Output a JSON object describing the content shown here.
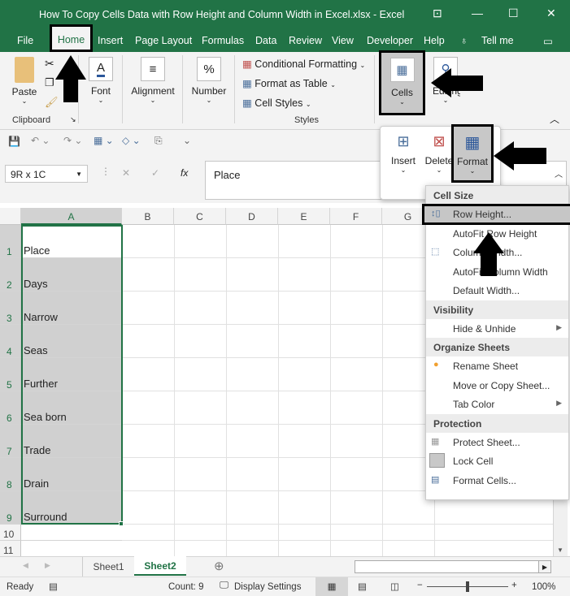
{
  "window": {
    "title": "How To Copy Cells Data with Row Height and Column Width in Excel.xlsx  -  Excel"
  },
  "menu": {
    "tabs": [
      "File",
      "Home",
      "Insert",
      "Page Layout",
      "Formulas",
      "Data",
      "Review",
      "View",
      "Developer",
      "Help"
    ],
    "tell_me": "Tell me"
  },
  "ribbon": {
    "paste": "Paste",
    "clipboard": "Clipboard",
    "font": "Font",
    "alignment": "Alignment",
    "number": "Number",
    "conditional_formatting": "Conditional Formatting",
    "format_as_table": "Format as Table",
    "cell_styles": "Cell Styles",
    "styles": "Styles",
    "cells": "Cells",
    "editing": "Editing"
  },
  "cells_popup": {
    "insert": "Insert",
    "delete": "Delete",
    "format": "Format"
  },
  "formula_bar": {
    "name_box": "9R x 1C",
    "fx": "fx",
    "value": "Place"
  },
  "grid": {
    "columns": [
      "A",
      "B",
      "C",
      "D",
      "E",
      "F",
      "G"
    ],
    "rows": [
      "1",
      "2",
      "3",
      "4",
      "5",
      "6",
      "7",
      "8",
      "9",
      "10",
      "11"
    ],
    "column_a": [
      "Place",
      "Days",
      "Narrow",
      "Seas",
      "Further",
      "Sea born",
      "Trade",
      "Drain",
      "Surround",
      "",
      ""
    ]
  },
  "format_menu": {
    "cell_size": "Cell Size",
    "row_height": "Row Height...",
    "autofit_row_height": "AutoFit Row Height",
    "column_width": "Column Width...",
    "autofit_column_width": "AutoFit Column Width",
    "default_width": "Default Width...",
    "visibility": "Visibility",
    "hide_unhide": "Hide & Unhide",
    "organize_sheets": "Organize Sheets",
    "rename_sheet": "Rename Sheet",
    "move_copy_sheet": "Move or Copy Sheet...",
    "tab_color": "Tab Color",
    "protection": "Protection",
    "protect_sheet": "Protect Sheet...",
    "lock_cell": "Lock Cell",
    "format_cells": "Format Cells..."
  },
  "sheets": [
    "Sheet1",
    "Sheet2"
  ],
  "status": {
    "ready": "Ready",
    "count": "Count: 9",
    "display_settings": "Display Settings",
    "zoom": "100%"
  },
  "colors": {
    "brand": "#217346",
    "selection": "#d0d0d0"
  }
}
